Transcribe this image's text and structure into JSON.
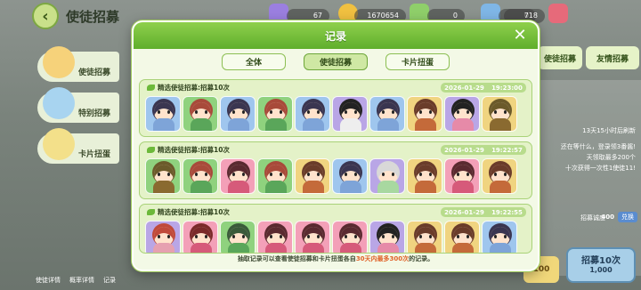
{
  "app": {
    "title": "使徒招募",
    "resources": [
      {
        "icon": "purple-gem-icon",
        "value": "67"
      },
      {
        "icon": "coin-icon",
        "value": "1670654"
      },
      {
        "icon": "green-leaf-icon",
        "value": "0"
      },
      {
        "icon": "blue-leaf-icon",
        "value": "0"
      },
      {
        "icon": "ticket-icon",
        "value": "718"
      }
    ],
    "side_tabs": [
      "使徒招募",
      "特别招募",
      "卡片扭蛋"
    ],
    "right_tabs": [
      "使徒招募",
      "友情招募"
    ],
    "right_panel": {
      "refresh": "13天15小时后刷新",
      "lines": [
        "还在等什么，登录领3番酱!",
        "天领取最多200个",
        "十次获得一次性1使徒11!"
      ],
      "sincerity_label": "招募诚度",
      "sincerity_value": "400",
      "exchange": "兑换"
    },
    "recruit_small": "100",
    "recruit_ten_label": "招募10次",
    "recruit_ten_cost": "1,000",
    "bottom_links": [
      "使徒详情",
      "概率详情",
      "记录"
    ]
  },
  "modal": {
    "title": "记录",
    "close_icon": "close-icon",
    "tabs": [
      {
        "label": "全体",
        "active": false
      },
      {
        "label": "使徒招募",
        "active": true
      },
      {
        "label": "卡片扭蛋",
        "active": false
      }
    ],
    "records": [
      {
        "title": "精选使徒招募:招募10次",
        "date": "2026-01-29",
        "time": "19:23:00",
        "cards": [
          {
            "bg": "#9fc6ee",
            "hair": "#3a3550",
            "cloth": "#7ea4d8"
          },
          {
            "bg": "#8fd27e",
            "hair": "#a84a3a",
            "cloth": "#5aa65a"
          },
          {
            "bg": "#9fc6ee",
            "hair": "#3a3550",
            "cloth": "#7ea4d8"
          },
          {
            "bg": "#8fd27e",
            "hair": "#a84a3a",
            "cloth": "#5aa65a"
          },
          {
            "bg": "#9fc6ee",
            "hair": "#3a3550",
            "cloth": "#7ea4d8"
          },
          {
            "bg": "#b9a6e6",
            "hair": "#222222",
            "cloth": "#eeeeee"
          },
          {
            "bg": "#9fc6ee",
            "hair": "#3a3550",
            "cloth": "#7ea4d8"
          },
          {
            "bg": "#f0d480",
            "hair": "#6a3c2a",
            "cloth": "#c46a3a"
          },
          {
            "bg": "#b9a6e6",
            "hair": "#222222",
            "cloth": "#e68aa8"
          },
          {
            "bg": "#f0d480",
            "hair": "#6b5a2a",
            "cloth": "#8a6a30"
          }
        ]
      },
      {
        "title": "精选使徒招募:招募10次",
        "date": "2026-01-29",
        "time": "19:22:57",
        "cards": [
          {
            "bg": "#8fd27e",
            "hair": "#6b5a2a",
            "cloth": "#8a6a30"
          },
          {
            "bg": "#8fd27e",
            "hair": "#a84a3a",
            "cloth": "#5aa65a"
          },
          {
            "bg": "#f3a0b8",
            "hair": "#5a2a30",
            "cloth": "#d65a7a"
          },
          {
            "bg": "#8fd27e",
            "hair": "#a84a3a",
            "cloth": "#5aa65a"
          },
          {
            "bg": "#f0d480",
            "hair": "#6a3c2a",
            "cloth": "#c46a3a"
          },
          {
            "bg": "#9fc6ee",
            "hair": "#3a3550",
            "cloth": "#7ea4d8"
          },
          {
            "bg": "#b9a6e6",
            "hair": "#d8d8d8",
            "cloth": "#a8d8a0"
          },
          {
            "bg": "#f0d480",
            "hair": "#6a3c2a",
            "cloth": "#c46a3a"
          },
          {
            "bg": "#f3a0b8",
            "hair": "#5a2a30",
            "cloth": "#d65a7a"
          },
          {
            "bg": "#f0d480",
            "hair": "#6a3c2a",
            "cloth": "#c46a3a"
          }
        ]
      },
      {
        "title": "精选使徒招募:招募10次",
        "date": "2026-01-29",
        "time": "19:22:55",
        "cards": [
          {
            "bg": "#b9a6e6",
            "hair": "#c04a3a",
            "cloth": "#e6a0b0"
          },
          {
            "bg": "#f3a0b8",
            "hair": "#7a2a2a",
            "cloth": "#d65a7a"
          },
          {
            "bg": "#8fd27e",
            "hair": "#3a5a3a",
            "cloth": "#5aa65a"
          },
          {
            "bg": "#f3a0b8",
            "hair": "#5a2a30",
            "cloth": "#d65a7a"
          },
          {
            "bg": "#f3a0b8",
            "hair": "#5a2a30",
            "cloth": "#d65a7a"
          },
          {
            "bg": "#f3a0b8",
            "hair": "#5a2a30",
            "cloth": "#d65a7a"
          },
          {
            "bg": "#b9a6e6",
            "hair": "#222222",
            "cloth": "#e68aa8"
          },
          {
            "bg": "#f0d480",
            "hair": "#6a3c2a",
            "cloth": "#c46a3a"
          },
          {
            "bg": "#f0d480",
            "hair": "#6a3c2a",
            "cloth": "#c46a3a"
          },
          {
            "bg": "#9fc6ee",
            "hair": "#3a3550",
            "cloth": "#7ea4d8"
          }
        ]
      }
    ],
    "footer": {
      "prefix": "抽取记录可以查看使徒招募和卡片扭蛋各自",
      "highlight": "30天内最多300次",
      "suffix": "的记录。"
    }
  }
}
